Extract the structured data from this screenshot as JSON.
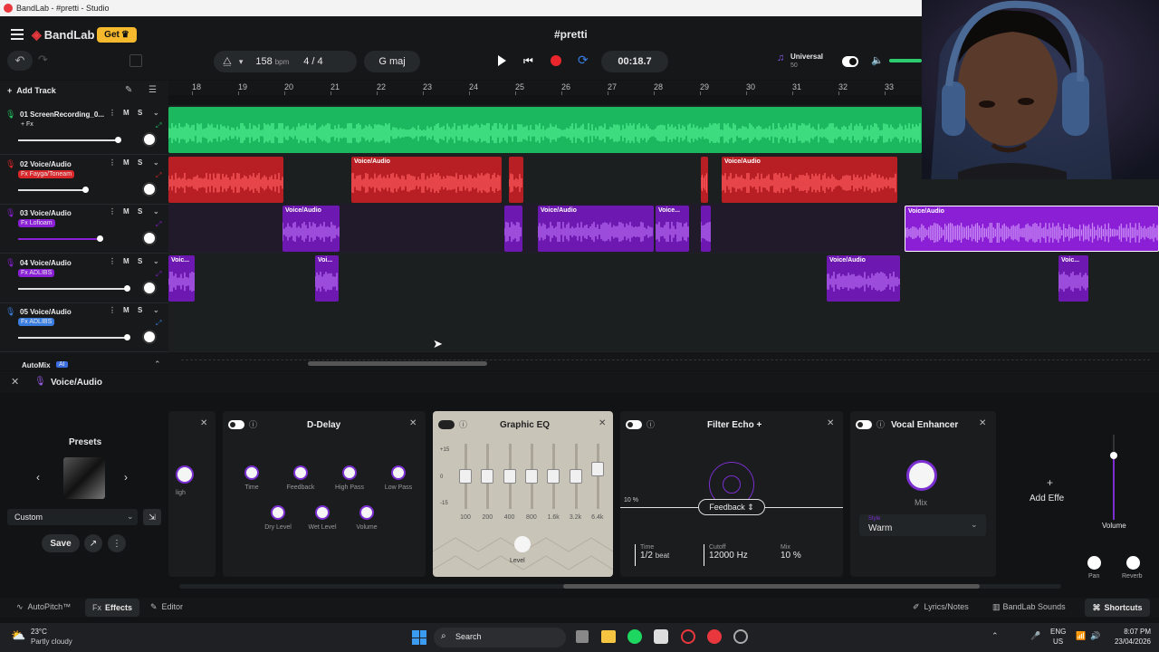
{
  "window": {
    "title": "BandLab - #pretti - Studio"
  },
  "header": {
    "brand": "BandLab",
    "get_label": "Get",
    "project_name": "#pretti",
    "bpm": "158",
    "bpm_unit": "bpm",
    "time_sig_num": "4",
    "time_sig_sep": "/",
    "time_sig_den": "4",
    "key": "G maj",
    "time": "00:18.7",
    "universal_label": "Universal",
    "universal_value": "50"
  },
  "timeline": {
    "add_track": "Add Track",
    "bars": [
      "18",
      "19",
      "20",
      "21",
      "22",
      "23",
      "24",
      "25",
      "26",
      "27",
      "28",
      "29",
      "30",
      "31",
      "32",
      "33"
    ]
  },
  "tracks": [
    {
      "name": "01  ScreenRecording_0...",
      "fx": "+ Fx",
      "color": "#21c162"
    },
    {
      "name": "02  Voice/Audio",
      "fx": "Fx Fayga/Toneam",
      "color": "#d9262b"
    },
    {
      "name": "03  Voice/Audio",
      "fx": "Fx Lofioam",
      "color": "#8a1fd6"
    },
    {
      "name": "04  Voice/Audio",
      "fx": "Fx ADLIBS",
      "color": "#8a1fd6"
    },
    {
      "name": "05  Voice/Audio",
      "fx": "Fx ADLIBS",
      "color": "#3a7de0"
    }
  ],
  "track_controls": {
    "mute": "M",
    "solo": "S"
  },
  "clip_label": "Voice/Audio",
  "clip_label_short": "Voic...",
  "clip_label_short2": "Voi...",
  "clip_label_short3": "Voice...",
  "automix": "AutoMix",
  "automix_badge": "AI",
  "fxpanel": {
    "track_label": "Voice/Audio",
    "presets_title": "Presets",
    "preset_value": "Custom",
    "save_label": "Save",
    "prev_panel_label": "ligh",
    "ddelay": {
      "title": "D-Delay",
      "knobs": [
        "Time",
        "Feedback",
        "High Pass",
        "Low Pass",
        "Dry Level",
        "Wet Level",
        "Volume"
      ]
    },
    "geq": {
      "title": "Graphic EQ",
      "scale": [
        "+15",
        "0",
        "-15"
      ],
      "bands": [
        "100",
        "200",
        "400",
        "800",
        "1.6k",
        "3.2k",
        "6.4k"
      ],
      "level_label": "Level"
    },
    "echo": {
      "title": "Filter Echo +",
      "pct": "10 %",
      "feedback": "Feedback",
      "time_label": "Time",
      "time_value": "1/2",
      "time_unit": "beat",
      "cutoff_label": "Cutoff",
      "cutoff_value": "12000 Hz",
      "mix_label": "Mix",
      "mix_value": "10 %"
    },
    "enhancer": {
      "title": "Vocal Enhancer",
      "mix_label": "Mix",
      "style_label": "Style",
      "style_value": "Warm"
    },
    "add_effect": "Add Effe",
    "volume_label": "Volume",
    "pan_label": "Pan",
    "reverb_label": "Reverb"
  },
  "bottom": {
    "autopitch": "AutoPitch™",
    "effects_prefix": "Fx",
    "effects": "Effects",
    "editor": "Editor",
    "lyrics": "Lyrics/Notes",
    "sounds": "BandLab Sounds",
    "shortcuts": "Shortcuts"
  },
  "taskbar": {
    "temp": "23°C",
    "weather": "Partly cloudy",
    "search": "Search",
    "lang1": "ENG",
    "lang2": "US",
    "time": "8:07 PM",
    "date": "23/04/2026"
  }
}
